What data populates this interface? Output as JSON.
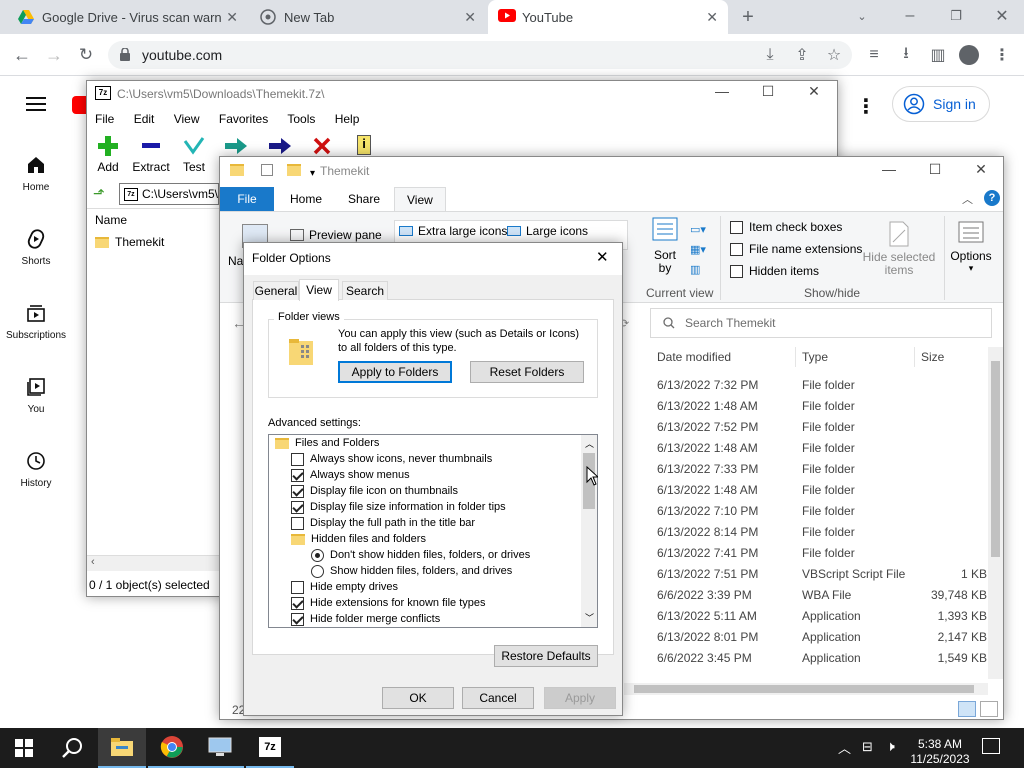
{
  "browser": {
    "tabs": [
      {
        "title": "Google Drive - Virus scan warning"
      },
      {
        "title": "New Tab"
      },
      {
        "title": "YouTube"
      }
    ],
    "url": "youtube.com"
  },
  "youtube": {
    "sign_in": "Sign in",
    "nav": [
      {
        "label": "Home"
      },
      {
        "label": "Shorts"
      },
      {
        "label": "Subscriptions"
      },
      {
        "label": "You"
      },
      {
        "label": "History"
      }
    ]
  },
  "sevenzip": {
    "title": "C:\\Users\\vm5\\Downloads\\Themekit.7z\\",
    "menu": [
      "File",
      "Edit",
      "View",
      "Favorites",
      "Tools",
      "Help"
    ],
    "tools": [
      {
        "label": "Add"
      },
      {
        "label": "Extract"
      },
      {
        "label": "Test"
      }
    ],
    "path": "C:\\Users\\vm5\\",
    "column_name": "Name",
    "item": "Themekit",
    "status": "0 / 1 object(s) selected"
  },
  "explorer": {
    "title": "Themekit",
    "ribbon_tabs": [
      "File",
      "Home",
      "Share",
      "View"
    ],
    "preview_pane": "Preview pane",
    "nav_pane_fragment": "Na",
    "layouts": [
      "Extra large icons",
      "Large icons"
    ],
    "sort_by": "Sort",
    "sort_by2": "by",
    "current_view": "Current view",
    "show_hide": {
      "item_check_boxes": "Item check boxes",
      "file_name_extensions": "File name extensions",
      "hidden_items": "Hidden items",
      "hide_selected": "Hide selected",
      "items": "items",
      "group": "Show/hide"
    },
    "options": "Options",
    "search_placeholder": "Search Themekit",
    "columns": {
      "date": "Date modified",
      "type": "Type",
      "size": "Size"
    },
    "rows": [
      {
        "date": "6/13/2022 7:32 PM",
        "type": "File folder",
        "size": ""
      },
      {
        "date": "6/13/2022 1:48 AM",
        "type": "File folder",
        "size": ""
      },
      {
        "date": "6/13/2022 7:52 PM",
        "type": "File folder",
        "size": ""
      },
      {
        "date": "6/13/2022 1:48 AM",
        "type": "File folder",
        "size": ""
      },
      {
        "date": "6/13/2022 7:33 PM",
        "type": "File folder",
        "size": ""
      },
      {
        "date": "6/13/2022 1:48 AM",
        "type": "File folder",
        "size": ""
      },
      {
        "date": "6/13/2022 7:10 PM",
        "type": "File folder",
        "size": ""
      },
      {
        "date": "6/13/2022 8:14 PM",
        "type": "File folder",
        "size": ""
      },
      {
        "date": "6/13/2022 7:41 PM",
        "type": "File folder",
        "size": ""
      },
      {
        "date": "6/13/2022 7:51 PM",
        "type": "VBScript Script File",
        "size": "1 KB"
      },
      {
        "date": "6/6/2022 3:39 PM",
        "type": "WBA File",
        "size": "39,748 KB"
      },
      {
        "date": "6/13/2022 5:11 AM",
        "type": "Application",
        "size": "1,393 KB"
      },
      {
        "date": "6/13/2022 8:01 PM",
        "type": "Application",
        "size": "2,147 KB"
      },
      {
        "date": "6/6/2022 3:45 PM",
        "type": "Application",
        "size": "1,549 KB"
      }
    ],
    "status_fragment": "22"
  },
  "dialog": {
    "title": "Folder Options",
    "tabs": [
      "General",
      "View",
      "Search"
    ],
    "folder_views_label": "Folder views",
    "folder_views_desc": "You can apply this view (such as Details or Icons) to all folders of this type.",
    "apply_to_folders": "Apply to Folders",
    "reset_folders": "Reset Folders",
    "advanced_label": "Advanced settings:",
    "settings": [
      {
        "kind": "folder",
        "label": "Files and Folders"
      },
      {
        "kind": "check",
        "checked": false,
        "label": "Always show icons, never thumbnails"
      },
      {
        "kind": "check",
        "checked": true,
        "label": "Always show menus"
      },
      {
        "kind": "check",
        "checked": true,
        "label": "Display file icon on thumbnails"
      },
      {
        "kind": "check",
        "checked": true,
        "label": "Display file size information in folder tips"
      },
      {
        "kind": "check",
        "checked": false,
        "label": "Display the full path in the title bar"
      },
      {
        "kind": "folder2",
        "label": "Hidden files and folders"
      },
      {
        "kind": "radio",
        "checked": true,
        "label": "Don't show hidden files, folders, or drives"
      },
      {
        "kind": "radio",
        "checked": false,
        "label": "Show hidden files, folders, and drives"
      },
      {
        "kind": "check",
        "checked": false,
        "label": "Hide empty drives"
      },
      {
        "kind": "check",
        "checked": true,
        "label": "Hide extensions for known file types"
      },
      {
        "kind": "check",
        "checked": true,
        "label": "Hide folder merge conflicts"
      }
    ],
    "restore_defaults": "Restore Defaults",
    "ok": "OK",
    "cancel": "Cancel",
    "apply": "Apply"
  },
  "taskbar": {
    "time": "5:38 AM",
    "date": "11/25/2023"
  },
  "colors": {
    "accent": "#0078d7",
    "youtube_red": "#ff0000",
    "taskbar": "#1c1c1c"
  }
}
